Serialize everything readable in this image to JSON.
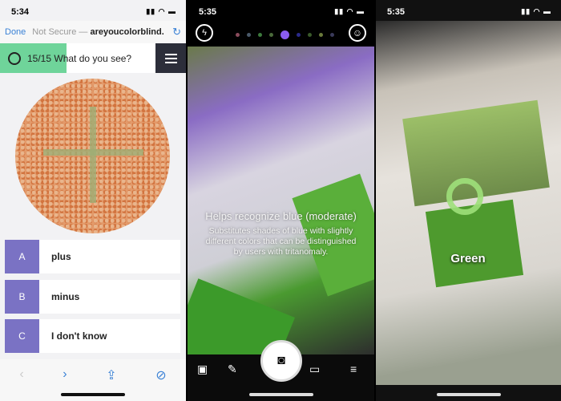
{
  "screens": [
    {
      "status": {
        "time": "5:34"
      },
      "browser": {
        "done": "Done",
        "not_secure": "Not Secure —",
        "domain": "areyoucolorblind."
      },
      "quiz": {
        "progress": "15/15",
        "question": "What do you see?",
        "progress_fraction": 1.0,
        "progress_color": "#6fd49a"
      },
      "answers": [
        {
          "letter": "A",
          "label": "plus"
        },
        {
          "letter": "B",
          "label": "minus"
        },
        {
          "letter": "C",
          "label": "I don't know"
        }
      ]
    },
    {
      "status": {
        "time": "5:35"
      },
      "filter": {
        "title": "Helps recognize blue (moderate)",
        "description": "Substitutes shades of blue with slightly different colors that can be distinguished by users with tritanomaly."
      },
      "filter_dots": [
        "#8a4b5c",
        "#4a5a6a",
        "#3c7a3c",
        "#4a6a3a",
        "#8a5cf0",
        "#2a2a8a",
        "#3a5a2a",
        "#6a7a3a",
        "#3a3a5a"
      ],
      "selected_dot": 4
    },
    {
      "status": {
        "time": "5:35"
      },
      "detected_color": "Green",
      "reticle_color": "#9ee07a"
    }
  ]
}
